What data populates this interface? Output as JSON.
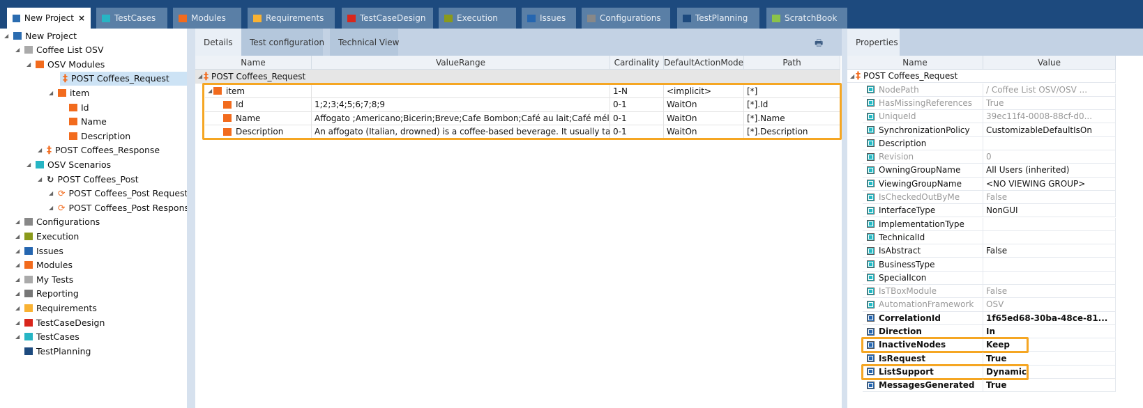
{
  "tabs": [
    {
      "label": "New Project",
      "color": "#2b6cb0",
      "active": true
    },
    {
      "label": "TestCases",
      "color": "#27b5c4"
    },
    {
      "label": "Modules",
      "color": "#f26b1d"
    },
    {
      "label": "Requirements",
      "color": "#f9b233"
    },
    {
      "label": "TestCaseDesign",
      "color": "#d9261c"
    },
    {
      "label": "Execution",
      "color": "#8a9a1b"
    },
    {
      "label": "Issues",
      "color": "#2566b0"
    },
    {
      "label": "Configurations",
      "color": "#888888"
    },
    {
      "label": "TestPlanning",
      "color": "#1d4a7e"
    },
    {
      "label": "ScratchBook",
      "color": "#8bc34a"
    }
  ],
  "close_label": "×",
  "tree": [
    {
      "label": "New Project",
      "level": 0,
      "icon": "project",
      "color": "#2b6cb0"
    },
    {
      "label": "Coffee List OSV",
      "level": 1,
      "icon": "folder",
      "color": "#aaaaaa"
    },
    {
      "label": "OSV Modules",
      "level": 2,
      "icon": "folder",
      "color": "#f26b1d"
    },
    {
      "label": "POST Coffees_Request",
      "level": 3,
      "icon": "module",
      "color": "#f26b1d",
      "selected": true
    },
    {
      "label": "item",
      "level": 4,
      "icon": "attr",
      "color": "#f26b1d"
    },
    {
      "label": "Id",
      "level": 5,
      "icon": "attr",
      "color": "#f26b1d"
    },
    {
      "label": "Name",
      "level": 5,
      "icon": "attr",
      "color": "#f26b1d"
    },
    {
      "label": "Description",
      "level": 5,
      "icon": "attr",
      "color": "#f26b1d"
    },
    {
      "label": "POST Coffees_Response",
      "level": 3,
      "icon": "module",
      "color": "#f26b1d"
    },
    {
      "label": "OSV Scenarios",
      "level": 2,
      "icon": "folder",
      "color": "#27b5c4"
    },
    {
      "label": "POST Coffees_Post",
      "level": 3,
      "icon": "scenario",
      "color": "#333333"
    },
    {
      "label": "POST Coffees_Post Request",
      "level": 4,
      "icon": "sync",
      "color": "#f26b1d"
    },
    {
      "label": "POST Coffees_Post Response",
      "level": 4,
      "icon": "sync",
      "color": "#f26b1d"
    },
    {
      "label": "Configurations",
      "level": 1,
      "icon": "folder",
      "color": "#888888"
    },
    {
      "label": "Execution",
      "level": 1,
      "icon": "folder",
      "color": "#8a9a1b"
    },
    {
      "label": "Issues",
      "level": 1,
      "icon": "folder",
      "color": "#2566b0"
    },
    {
      "label": "Modules",
      "level": 1,
      "icon": "folder",
      "color": "#f26b1d"
    },
    {
      "label": "My Tests",
      "level": 1,
      "icon": "folder",
      "color": "#aaaaaa"
    },
    {
      "label": "Reporting",
      "level": 1,
      "icon": "folder",
      "color": "#777777"
    },
    {
      "label": "Requirements",
      "level": 1,
      "icon": "folder",
      "color": "#f9b233"
    },
    {
      "label": "TestCaseDesign",
      "level": 1,
      "icon": "folder",
      "color": "#d9261c"
    },
    {
      "label": "TestCases",
      "level": 1,
      "icon": "folder",
      "color": "#27b5c4"
    },
    {
      "label": "TestPlanning",
      "level": 1,
      "icon": "folder",
      "color": "#1d4a7e"
    }
  ],
  "center": {
    "subtabs": [
      "Details",
      "Test configuration",
      "Technical View"
    ],
    "columns": [
      "Name",
      "ValueRange",
      "Cardinality",
      "DefaultActionMode",
      "Path"
    ],
    "root": "POST Coffees_Request",
    "rows": [
      {
        "name": "item",
        "valuerange": "",
        "cardinality": "1-N",
        "mode": "<implicit>",
        "path": "[*]",
        "level": 0
      },
      {
        "name": "Id",
        "valuerange": "1;2;3;4;5;6;7;8;9",
        "cardinality": "0-1",
        "mode": "WaitOn",
        "path": "[*].Id",
        "level": 1
      },
      {
        "name": "Name",
        "valuerange": "Affogato ;Americano;Bicerin;Breve;Cafe Bombon;Café au lait;Café mélan...",
        "cardinality": "0-1",
        "mode": "WaitOn",
        "path": "[*].Name",
        "level": 1
      },
      {
        "name": "Description",
        "valuerange": "An affogato (Italian, drowned) is a coffee-based beverage. It usually takes...",
        "cardinality": "0-1",
        "mode": "WaitOn",
        "path": "[*].Description",
        "level": 1
      }
    ]
  },
  "properties": {
    "tab": "Properties",
    "columns": [
      "Name",
      "Value"
    ],
    "root": "POST Coffees_Request",
    "rows": [
      {
        "name": "NodePath",
        "value": "/ Coffee List OSV/OSV ...",
        "dim": true
      },
      {
        "name": "HasMissingReferences",
        "value": "True",
        "dim": true
      },
      {
        "name": "UniqueId",
        "value": "39ec11f4-0008-88cf-d0...",
        "dim": true
      },
      {
        "name": "SynchronizationPolicy",
        "value": "CustomizableDefaultIsOn"
      },
      {
        "name": "Description",
        "value": ""
      },
      {
        "name": "Revision",
        "value": "0",
        "dim": true
      },
      {
        "name": "OwningGroupName",
        "value": "All Users (inherited)"
      },
      {
        "name": "ViewingGroupName",
        "value": "<NO VIEWING GROUP>"
      },
      {
        "name": "IsCheckedOutByMe",
        "value": "False",
        "dim": true
      },
      {
        "name": "InterfaceType",
        "value": "NonGUI"
      },
      {
        "name": "ImplementationType",
        "value": ""
      },
      {
        "name": "TechnicalId",
        "value": ""
      },
      {
        "name": "IsAbstract",
        "value": "False"
      },
      {
        "name": "BusinessType",
        "value": ""
      },
      {
        "name": "SpecialIcon",
        "value": ""
      },
      {
        "name": "IsTBoxModule",
        "value": "False",
        "dim": true
      },
      {
        "name": "AutomationFramework",
        "value": "OSV",
        "dim": true
      },
      {
        "name": "CorrelationId",
        "value": "1f65ed68-30ba-48ce-81...",
        "bold": true
      },
      {
        "name": "Direction",
        "value": "In",
        "bold": true
      },
      {
        "name": "InactiveNodes",
        "value": "Keep",
        "bold": true,
        "highlight": true
      },
      {
        "name": "IsRequest",
        "value": "True",
        "bold": true
      },
      {
        "name": "ListSupport",
        "value": "Dynamic",
        "bold": true,
        "highlight": true
      },
      {
        "name": "MessagesGenerated",
        "value": "True",
        "bold": true
      }
    ]
  },
  "colors": {
    "highlight": "#f5a623",
    "accent": "#1d4a7e"
  }
}
